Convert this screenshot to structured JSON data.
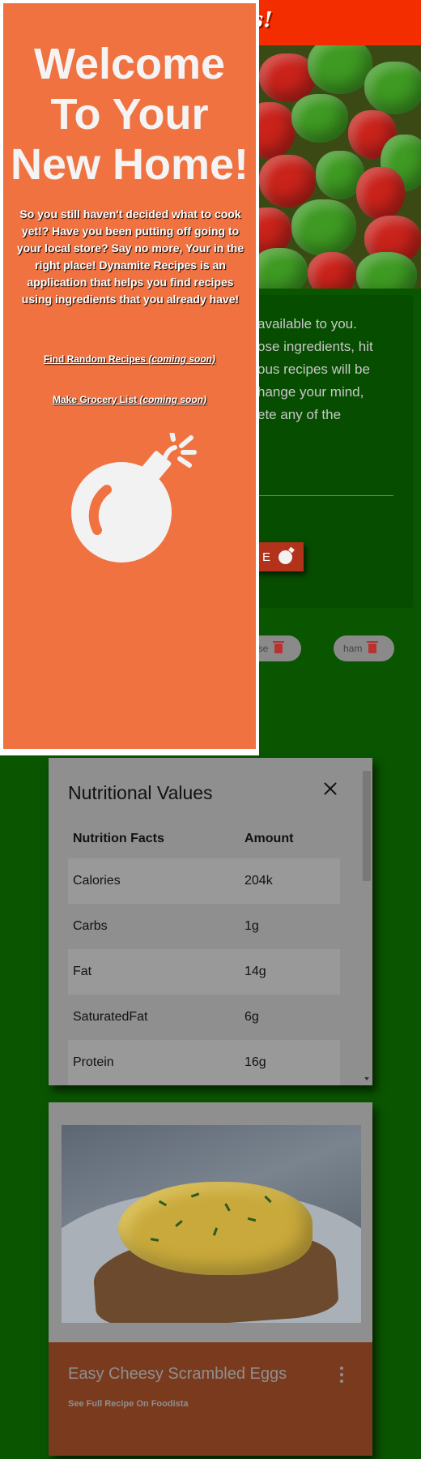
{
  "header": {
    "title_fragment": "cipes!"
  },
  "intro": {
    "text": "available to you.\nose ingredients, hit\nous recipes will be\nhange your mind,\nete any of the",
    "button_label": "E"
  },
  "ingredients": [
    {
      "label": "ese",
      "icon": "trash-icon"
    },
    {
      "label": "ham",
      "icon": "trash-icon"
    }
  ],
  "nutrition": {
    "title": "Nutritional Values",
    "headers": [
      "Nutrition Facts",
      "Amount"
    ],
    "rows": [
      {
        "name": "Calories",
        "amount": "204k"
      },
      {
        "name": "Carbs",
        "amount": "1g"
      },
      {
        "name": "Fat",
        "amount": "14g"
      },
      {
        "name": "SaturatedFat",
        "amount": "6g"
      },
      {
        "name": "Protein",
        "amount": "16g"
      }
    ]
  },
  "recipe": {
    "title": "Easy Cheesy Scrambled Eggs",
    "link": "See Full Recipe On Foodista"
  },
  "welcome": {
    "title": "Welcome\nTo Your\nNew Home!",
    "body": "So you still haven't decided what to cook\nyet!? Have you been putting off going to\nyour local store? Say no more, Your in the\nright place! Dynamite Recipes is an\napplication that helps you find recipes\nusing ingredients that you already have!",
    "link1_text": "Find Random Recipes ",
    "link1_note": "(coming soon)",
    "link2_text": "Make Grocery List ",
    "link2_note": "(coming soon)"
  },
  "colors": {
    "page_bg": "#0a5500",
    "top_bar": "#f32d00",
    "welcome_bg": "#f07240",
    "dialog_bg": "#8f8f8f",
    "recipe_footer": "#7a3a1e"
  }
}
